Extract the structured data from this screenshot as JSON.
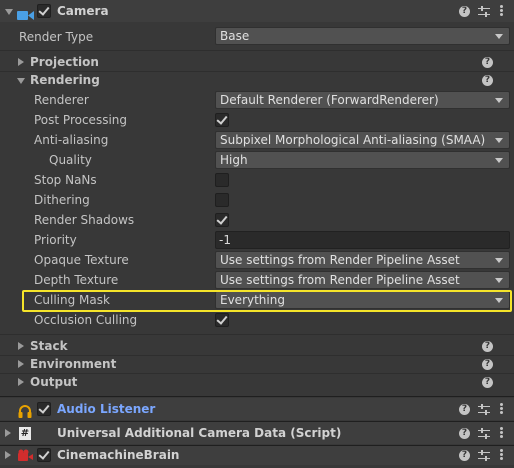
{
  "camera": {
    "title": "Camera",
    "render_type": {
      "label": "Render Type",
      "value": "Base"
    },
    "sections": {
      "projection": "Projection",
      "rendering": "Rendering",
      "stack": "Stack",
      "environment": "Environment",
      "output": "Output"
    },
    "rendering": {
      "renderer": {
        "label": "Renderer",
        "value": "Default Renderer (ForwardRenderer)"
      },
      "post_processing": {
        "label": "Post Processing",
        "checked": true
      },
      "anti_aliasing": {
        "label": "Anti-aliasing",
        "value": "Subpixel Morphological Anti-aliasing (SMAA)"
      },
      "quality": {
        "label": "Quality",
        "value": "High"
      },
      "stop_nans": {
        "label": "Stop NaNs",
        "checked": false
      },
      "dithering": {
        "label": "Dithering",
        "checked": false
      },
      "render_shadows": {
        "label": "Render Shadows",
        "checked": true
      },
      "priority": {
        "label": "Priority",
        "value": "-1"
      },
      "opaque_texture": {
        "label": "Opaque Texture",
        "value": "Use settings from Render Pipeline Asset"
      },
      "depth_texture": {
        "label": "Depth Texture",
        "value": "Use settings from Render Pipeline Asset"
      },
      "culling_mask": {
        "label": "Culling Mask",
        "value": "Everything"
      },
      "occlusion_culling": {
        "label": "Occlusion Culling",
        "checked": true
      }
    }
  },
  "components": {
    "audio_listener": "Audio Listener",
    "camera_data": "Universal Additional Camera Data (Script)",
    "cinemachine_brain": "CinemachineBrain"
  },
  "colors": {
    "background": "#383838",
    "highlight": "#f5e42a",
    "link_blue": "#7ba7ff",
    "camera_icon": "#4aa0e6",
    "audio_icon": "#e8a200",
    "cinemachine_icon": "#d22d2d"
  },
  "icons": {
    "camera": "camera-icon",
    "help": "help-icon",
    "presets": "presets-icon",
    "menu": "kebab-menu-icon",
    "audio": "headphones-icon",
    "script": "script-hash-icon",
    "cinemachine": "cinemachine-icon"
  }
}
